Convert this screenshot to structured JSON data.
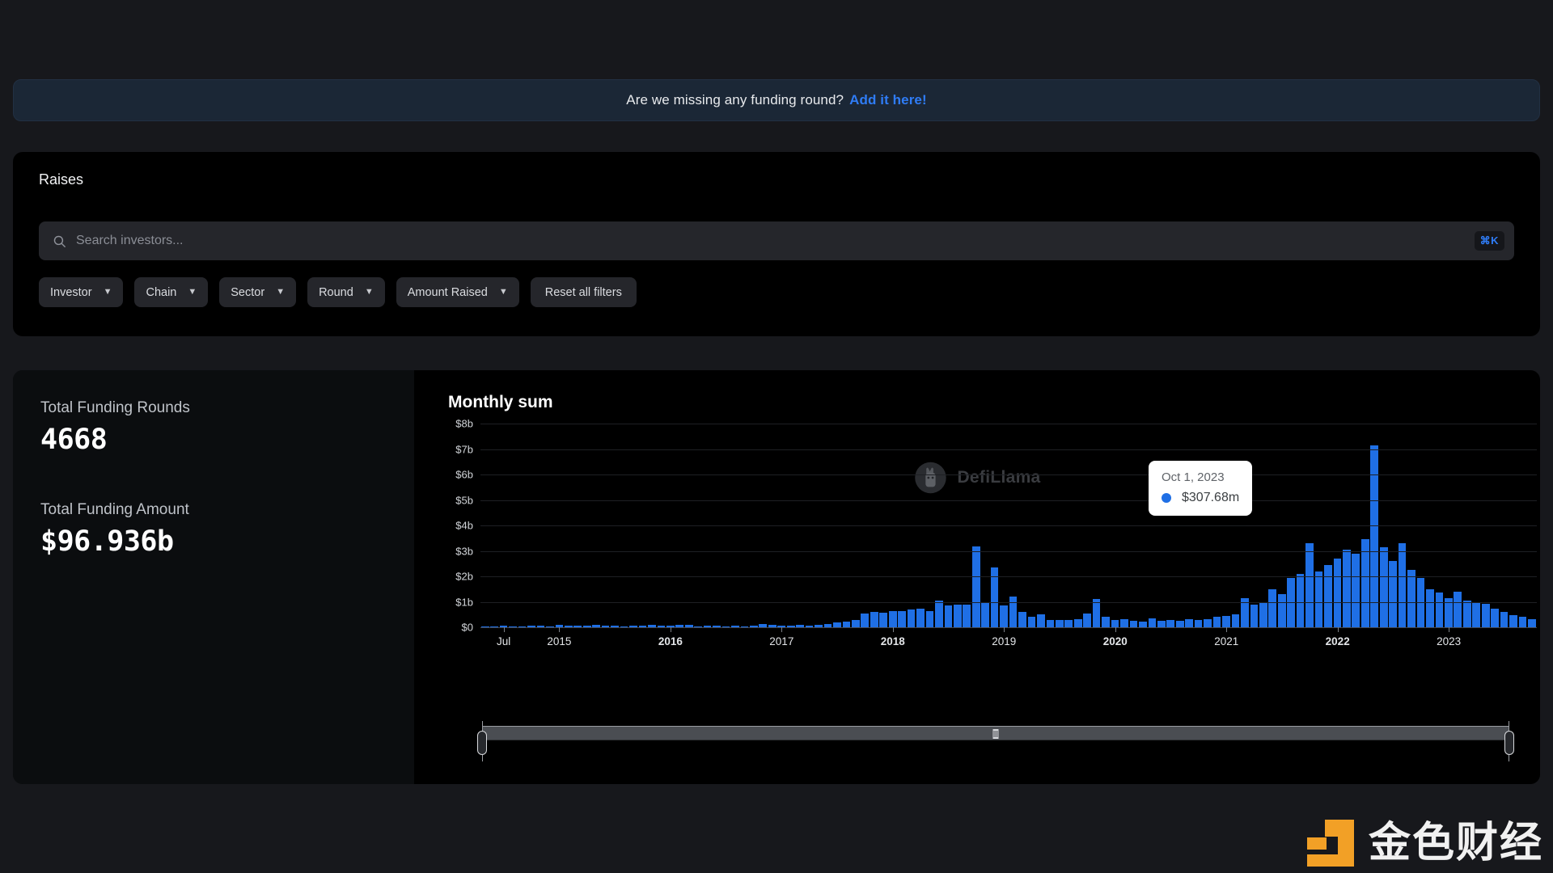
{
  "banner": {
    "text": "Are we missing any funding round?",
    "link_label": "Add it here!",
    "link_color": "#2f7cf6"
  },
  "raises": {
    "title": "Raises",
    "search": {
      "placeholder": "Search investors...",
      "value": "",
      "shortcut_badge": "⌘K",
      "icon": "search-icon"
    },
    "filters": [
      {
        "label": "Investor",
        "icon": "chevron-down-icon"
      },
      {
        "label": "Chain",
        "icon": "chevron-down-icon"
      },
      {
        "label": "Sector",
        "icon": "chevron-down-icon"
      },
      {
        "label": "Round",
        "icon": "chevron-down-icon"
      },
      {
        "label": "Amount Raised",
        "icon": "chevron-down-icon"
      }
    ],
    "reset_label": "Reset all filters"
  },
  "stats": [
    {
      "label": "Total Funding Rounds",
      "value": "4668"
    },
    {
      "label": "Total Funding Amount",
      "value": "$96.936b"
    }
  ],
  "watermark": {
    "text": "DefiLlama",
    "logo": "llama-logo-icon"
  },
  "site_logo": {
    "text": "金色财经",
    "accent": "#f2a026"
  },
  "tooltip": {
    "date": "Oct 1, 2023",
    "value": "$307.68m",
    "dot_color": "#1f6fe5"
  },
  "brush": {
    "grip": "drag-grip-icon",
    "left_handle": "brush-handle-left",
    "right_handle": "brush-handle-right"
  },
  "chart_data": {
    "type": "bar",
    "title": "Monthly sum",
    "xlabel": "",
    "ylabel": "",
    "ylim": [
      0,
      8
    ],
    "yunit": "b",
    "grid": true,
    "legend": "none",
    "bar_color": "#1f6fe5",
    "ytick_labels": [
      "$8b",
      "$7b",
      "$6b",
      "$5b",
      "$4b",
      "$3b",
      "$2b",
      "$1b",
      "$0"
    ],
    "ytick_values": [
      8,
      7,
      6,
      5,
      4,
      3,
      2,
      1,
      0
    ],
    "xtick_labels": [
      "Jul",
      "2015",
      "2016",
      "2017",
      "2018",
      "2019",
      "2020",
      "2021",
      "2022",
      "2023"
    ],
    "xtick_bold": [
      false,
      false,
      true,
      false,
      true,
      false,
      true,
      false,
      true,
      false
    ],
    "xtick_indices": [
      2,
      8,
      20,
      32,
      44,
      56,
      68,
      80,
      92,
      104
    ],
    "annotation": {
      "type": "dashed-vertical-line",
      "index": 116,
      "color": "#d7d9dd"
    },
    "categories": [
      "2014-05",
      "2014-06",
      "2014-07",
      "2014-08",
      "2014-09",
      "2014-10",
      "2014-11",
      "2014-12",
      "2015-01",
      "2015-02",
      "2015-03",
      "2015-04",
      "2015-05",
      "2015-06",
      "2015-07",
      "2015-08",
      "2015-09",
      "2015-10",
      "2015-11",
      "2015-12",
      "2016-01",
      "2016-02",
      "2016-03",
      "2016-04",
      "2016-05",
      "2016-06",
      "2016-07",
      "2016-08",
      "2016-09",
      "2016-10",
      "2016-11",
      "2016-12",
      "2017-01",
      "2017-02",
      "2017-03",
      "2017-04",
      "2017-05",
      "2017-06",
      "2017-07",
      "2017-08",
      "2017-09",
      "2017-10",
      "2017-11",
      "2017-12",
      "2018-01",
      "2018-02",
      "2018-03",
      "2018-04",
      "2018-05",
      "2018-06",
      "2018-07",
      "2018-08",
      "2018-09",
      "2018-10",
      "2018-11",
      "2018-12",
      "2019-01",
      "2019-02",
      "2019-03",
      "2019-04",
      "2019-05",
      "2019-06",
      "2019-07",
      "2019-08",
      "2019-09",
      "2019-10",
      "2019-11",
      "2019-12",
      "2020-01",
      "2020-02",
      "2020-03",
      "2020-04",
      "2020-05",
      "2020-06",
      "2020-07",
      "2020-08",
      "2020-09",
      "2020-10",
      "2020-11",
      "2020-12",
      "2021-01",
      "2021-02",
      "2021-03",
      "2021-04",
      "2021-05",
      "2021-06",
      "2021-07",
      "2021-08",
      "2021-09",
      "2021-10",
      "2021-11",
      "2021-12",
      "2022-01",
      "2022-02",
      "2022-03",
      "2022-04",
      "2022-05",
      "2022-06",
      "2022-07",
      "2022-08",
      "2022-09",
      "2022-10",
      "2022-11",
      "2022-12",
      "2023-01",
      "2023-02",
      "2023-03",
      "2023-04",
      "2023-05",
      "2023-06",
      "2023-07",
      "2023-08",
      "2023-09",
      "2023-10"
    ],
    "values": [
      0.02,
      0.03,
      0.05,
      0.04,
      0.03,
      0.06,
      0.05,
      0.04,
      0.1,
      0.06,
      0.07,
      0.05,
      0.09,
      0.06,
      0.05,
      0.04,
      0.06,
      0.05,
      0.08,
      0.06,
      0.05,
      0.1,
      0.09,
      0.04,
      0.06,
      0.05,
      0.04,
      0.07,
      0.04,
      0.05,
      0.12,
      0.11,
      0.06,
      0.05,
      0.08,
      0.06,
      0.1,
      0.14,
      0.18,
      0.22,
      0.3,
      0.55,
      0.6,
      0.58,
      0.62,
      0.65,
      0.7,
      0.72,
      0.62,
      1.05,
      0.85,
      0.9,
      0.88,
      3.18,
      1.0,
      2.35,
      0.85,
      1.2,
      0.6,
      0.42,
      0.52,
      0.3,
      0.28,
      0.3,
      0.32,
      0.55,
      1.1,
      0.4,
      0.3,
      0.32,
      0.25,
      0.22,
      0.35,
      0.24,
      0.28,
      0.26,
      0.32,
      0.3,
      0.33,
      0.4,
      0.45,
      0.5,
      1.15,
      0.88,
      0.95,
      1.5,
      1.3,
      1.95,
      2.1,
      3.3,
      2.2,
      2.45,
      2.7,
      3.05,
      2.9,
      3.45,
      7.15,
      3.15,
      2.6,
      3.3,
      2.25,
      1.95,
      1.5,
      1.35,
      1.15,
      1.4,
      1.05,
      1.0,
      0.92,
      0.72,
      0.6,
      0.48,
      0.4,
      0.32
    ],
    "minimap_values": [
      0.02,
      0.03,
      0.05,
      0.04,
      0.03,
      0.06,
      0.05,
      0.04,
      0.1,
      0.06,
      0.07,
      0.05,
      0.09,
      0.06,
      0.05,
      0.04,
      0.06,
      0.05,
      0.08,
      0.06,
      0.05,
      0.1,
      0.09,
      0.04,
      0.06,
      0.05,
      0.04,
      0.07,
      0.04,
      0.05,
      0.12,
      0.11,
      0.06,
      0.05,
      0.08,
      0.06,
      0.1,
      0.14,
      0.18,
      0.22,
      0.3,
      0.55,
      0.6,
      0.58,
      0.62,
      0.65,
      0.7,
      0.72,
      0.62,
      1.05,
      0.85,
      0.9,
      0.88,
      3.18,
      1.0,
      2.35,
      0.85,
      1.2,
      0.6,
      0.42,
      0.52,
      0.3,
      0.28,
      0.3,
      0.32,
      0.55,
      1.1,
      0.4,
      0.3,
      0.32,
      0.25,
      0.22,
      0.35,
      0.24,
      0.28,
      0.26,
      0.32,
      0.3,
      0.33,
      0.4,
      0.45,
      0.5,
      1.15,
      0.88,
      0.95,
      1.5,
      1.3,
      1.95,
      2.1,
      3.3,
      2.2,
      2.45,
      2.7,
      3.05,
      2.9,
      3.45,
      7.15,
      3.15,
      2.6,
      3.3,
      2.25,
      1.95,
      1.5,
      1.35,
      1.15,
      1.4,
      1.05,
      1.0,
      0.92,
      0.72,
      0.6,
      0.48,
      0.4,
      0.32
    ],
    "highlight": {
      "category": "2023-10",
      "label": "Oct 1, 2023",
      "value_label": "$307.68m",
      "value": 0.30768
    }
  }
}
